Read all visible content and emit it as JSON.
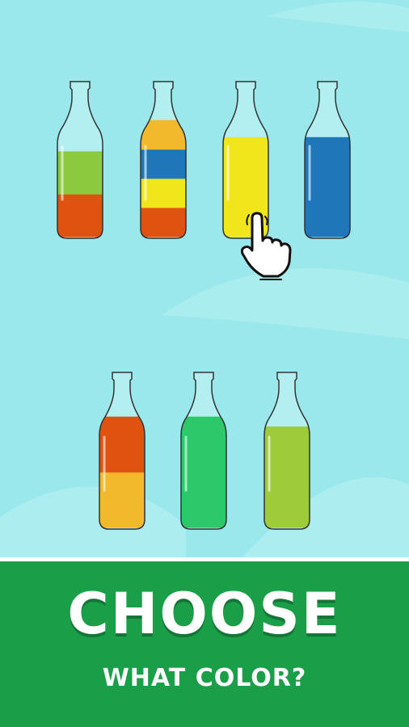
{
  "banner": {
    "title": "CHOOSE",
    "subtitle": "WHAT COLOR?"
  },
  "colors": {
    "background": "#9ae8ec",
    "banner": "#1a9e48"
  },
  "bottles": [
    {
      "layers": [
        "#e05210",
        "#8cc93e"
      ],
      "fill_fraction": 0.6
    },
    {
      "layers": [
        "#e05210",
        "#f1e51c",
        "#1f76b8",
        "#f1b92b"
      ],
      "fill_fraction": 0.82
    },
    {
      "layers": [
        "#f1e51c"
      ],
      "fill_fraction": 0.7
    },
    {
      "layers": [
        "#1f76b8"
      ],
      "fill_fraction": 0.7
    },
    {
      "layers": [
        "#f1b92b",
        "#e05210"
      ],
      "fill_fraction": 0.78
    },
    {
      "layers": [
        "#2dc86a"
      ],
      "fill_fraction": 0.78
    },
    {
      "layers": [
        "#9ecb3a"
      ],
      "fill_fraction": 0.71
    }
  ],
  "icons": {
    "hand": "pointing-hand-icon"
  }
}
